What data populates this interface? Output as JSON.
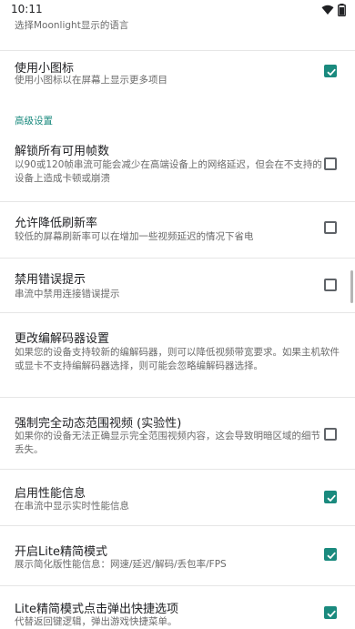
{
  "status_bar": {
    "time": "10:11"
  },
  "language_pref": {
    "summary": "选择Moonlight显示的语言"
  },
  "small_icons": {
    "title": "使用小图标",
    "summary": "使用小图标以在屏幕上显示更多项目",
    "checked": true
  },
  "advanced_category": "高级设置",
  "unlock_fps": {
    "title": "解锁所有可用帧数",
    "summary": "以90或120帧串流可能会减少在高端设备上的网络延迟，但会在不支持的设备上造成卡顿或崩溃",
    "checked": false
  },
  "reduce_refresh": {
    "title": "允许降低刷新率",
    "summary": "较低的屏幕刷新率可以在增加一些视频延迟的情况下省电",
    "checked": false
  },
  "disable_warnings": {
    "title": "禁用错误提示",
    "summary": "串流中禁用连接错误提示",
    "checked": false
  },
  "codec": {
    "title": "更改编解码器设置",
    "summary": "如果您的设备支持较新的编解码器，则可以降低视频带宽要求。如果主机软件或显卡不支持编解码器选择，则可能会忽略编解码器选择。"
  },
  "hdr": {
    "title": "强制完全动态范围视频 (实验性)",
    "summary": "如果你的设备无法正确显示完全范围视频内容，这会导致明暗区域的细节丢失。",
    "checked": false
  },
  "perf_overlay": {
    "title": "启用性能信息",
    "summary": "在串流中显示实时性能信息",
    "checked": true
  },
  "lite_mode": {
    "title": "开启Lite精简模式",
    "summary": "展示简化版性能信息：网速/延迟/解码/丢包率/FPS",
    "checked": true
  },
  "lite_quick_menu": {
    "title": "Lite精简模式点击弹出快捷选项",
    "summary": "代替返回键逻辑，弹出游戏快捷菜单。",
    "checked": true
  },
  "colors": {
    "accent": "#1a8a7e",
    "checkbox_outline": "#5f6368"
  },
  "icons": [
    "wifi-icon",
    "battery-icon"
  ]
}
